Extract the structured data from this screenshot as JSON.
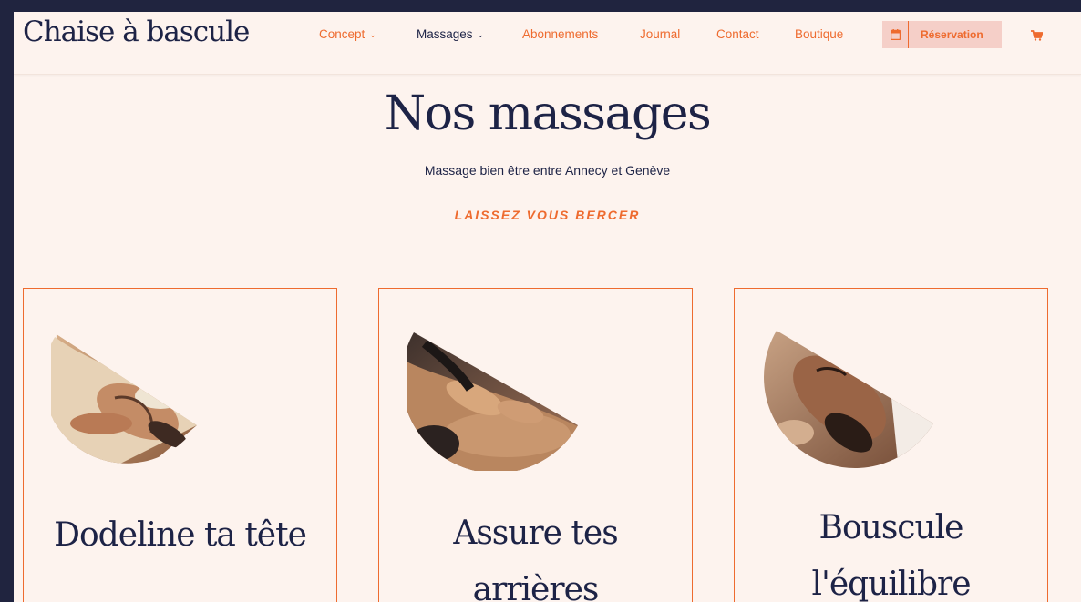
{
  "header": {
    "logo": "Chaise à bascule",
    "nav": [
      {
        "label": "Concept",
        "dropdown": true
      },
      {
        "label": "Massages",
        "dropdown": true,
        "active": true
      },
      {
        "label": "Abonnements",
        "dropdown": false
      },
      {
        "label": "Journal",
        "dropdown": false
      },
      {
        "label": "Contact",
        "dropdown": false
      },
      {
        "label": "Boutique",
        "dropdown": false
      }
    ],
    "reservation_label": "Réservation",
    "reservation_icon": "calendar-icon",
    "cart_icon": "cart-icon"
  },
  "hero": {
    "title": "Nos massages",
    "subtitle": "Massage bien être entre Annecy et Genève",
    "tagline": "LAISSEZ VOUS BERCER"
  },
  "cards": [
    {
      "title_lines": [
        "Dodeline ta tête"
      ],
      "photo": "head-massage-photo"
    },
    {
      "title_lines": [
        "Assure tes",
        "arrières"
      ],
      "photo": "back-massage-photo"
    },
    {
      "title_lines": [
        "Bouscule",
        "l'équilibre"
      ],
      "photo": "face-massage-photo"
    }
  ],
  "colors": {
    "background": "#fdf3ee",
    "accent": "#ee6b2f",
    "navy": "#1d2346",
    "reservation_bg": "#f5cfc8",
    "frame": "#20243f"
  }
}
